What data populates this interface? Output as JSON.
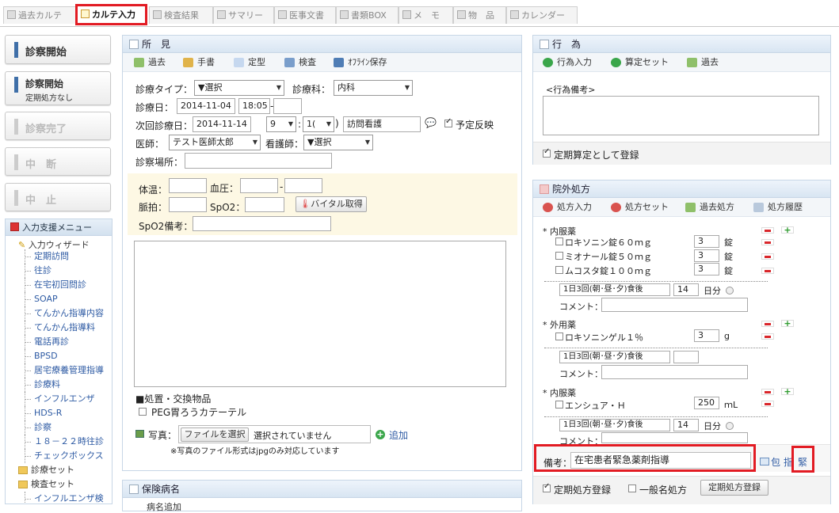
{
  "tabs": [
    {
      "label": "過去カルテ"
    },
    {
      "label": "カルテ入力"
    },
    {
      "label": "検査結果"
    },
    {
      "label": "サマリー"
    },
    {
      "label": "医事文書"
    },
    {
      "label": "書類BOX"
    },
    {
      "label": "メ　モ"
    },
    {
      "label": "物　品"
    },
    {
      "label": "カレンダー"
    }
  ],
  "left_buttons": {
    "start": "診察開始",
    "start_fixed": "診察開始",
    "start_fixed_sub": "定期処方なし",
    "complete": "診察完了",
    "pause": "中　断",
    "stop": "中　止"
  },
  "menu": {
    "title": "入力支援メニュー",
    "wizard": "入力ウィザード",
    "items": [
      "定期訪問",
      "往診",
      "在宅初回問診",
      "SOAP",
      "てんかん指導内容",
      "てんかん指導料",
      "電話再診",
      "BPSD",
      "居宅療養管理指導",
      "診療料",
      "インフルエンザ",
      "HDS-R",
      "診察",
      "１８－２２時往診",
      "チェックボックス"
    ],
    "folders": [
      "診療セット",
      "検査セット",
      "インフルエンザ検"
    ]
  },
  "shoken": {
    "title": "所　見",
    "toolbar": [
      "過去",
      "手書",
      "定型",
      "検査",
      "ｵﾌﾗｲﾝ保存"
    ],
    "type_label": "診療タイプ：",
    "type_value": "▼選択",
    "dept_label": "診療科：",
    "dept_value": "内科",
    "date_label": "診療日：",
    "date_value": "2014-11-04",
    "time_value": "18:05",
    "time_sep": "-",
    "next_label": "次回診療日：",
    "next_date": "2014-11-14",
    "next_hour": "9",
    "next_colon": ":",
    "next_min": "1(",
    "next_paren": ")",
    "next_service": "訪問看護",
    "reflect_label": "予定反映",
    "doctor_label": "医師：",
    "doctor_value": "テスト医師太郎",
    "nurse_label": "看護師：",
    "nurse_value": "▼選択",
    "place_label": "診察場所：",
    "temp_label": "体温：",
    "bp_label": "血圧：",
    "bp_sep": "-",
    "pulse_label": "脈拍：",
    "spo2_label": "SpO2：",
    "vital_btn": "バイタル取得",
    "spo2_note_label": "SpO2備考：",
    "treat_title": "■処置・交換物品",
    "peg_label": "PEG胃ろうカテーテル",
    "photo_label": "写真：",
    "file_btn": "ファイルを選択",
    "file_none": "選択されていません",
    "add_label": "追加",
    "photo_note": "※写真のファイル形式はjpgのみ対応しています"
  },
  "disease": {
    "title": "保険病名",
    "tab": "病名追加"
  },
  "koui": {
    "title": "行　為",
    "toolbar": [
      "行為入力",
      "算定セット",
      "過去"
    ],
    "note_placeholder": "<行為備考>",
    "regular_label": "定期算定として登録"
  },
  "rx": {
    "title": "院外処方",
    "toolbar": [
      "処方入力",
      "処方セット",
      "過去処方",
      "処方履歴"
    ],
    "groups": [
      {
        "header": "* 内服薬",
        "drugs": [
          {
            "name": "ロキソニン錠６０ｍｇ",
            "qty": "3",
            "unit": "錠"
          },
          {
            "name": "ミオナール錠５０ｍｇ",
            "qty": "3",
            "unit": "錠"
          },
          {
            "name": "ムコスタ錠１００ｍｇ",
            "qty": "3",
            "unit": "錠"
          }
        ],
        "usage": "1日3回(朝･昼･夕)食後",
        "days": "14",
        "days_unit": "日分",
        "comment_label": "コメント："
      },
      {
        "header": "* 外用薬",
        "drugs": [
          {
            "name": "ロキソニンゲル１％",
            "qty": "3",
            "unit": "g"
          }
        ],
        "usage": "1日3回(朝･昼･夕)食後",
        "days": "",
        "days_unit": "",
        "comment_label": "コメント："
      },
      {
        "header": "* 内服薬",
        "drugs": [
          {
            "name": "エンシュア・Ｈ",
            "qty": "250",
            "unit": "ｍL"
          }
        ],
        "usage": "1日3回(朝･昼･夕)食後",
        "days": "14",
        "days_unit": "日分",
        "comment_label": "コメント："
      }
    ],
    "remarks_label": "備考：",
    "remarks_value": "在宅患者緊急薬剤指導",
    "side_links": [
      "包",
      "指",
      "緊"
    ],
    "regular_label": "定期処方登録",
    "generic_label": "一般名処方",
    "regular_btn": "定期処方登録"
  }
}
